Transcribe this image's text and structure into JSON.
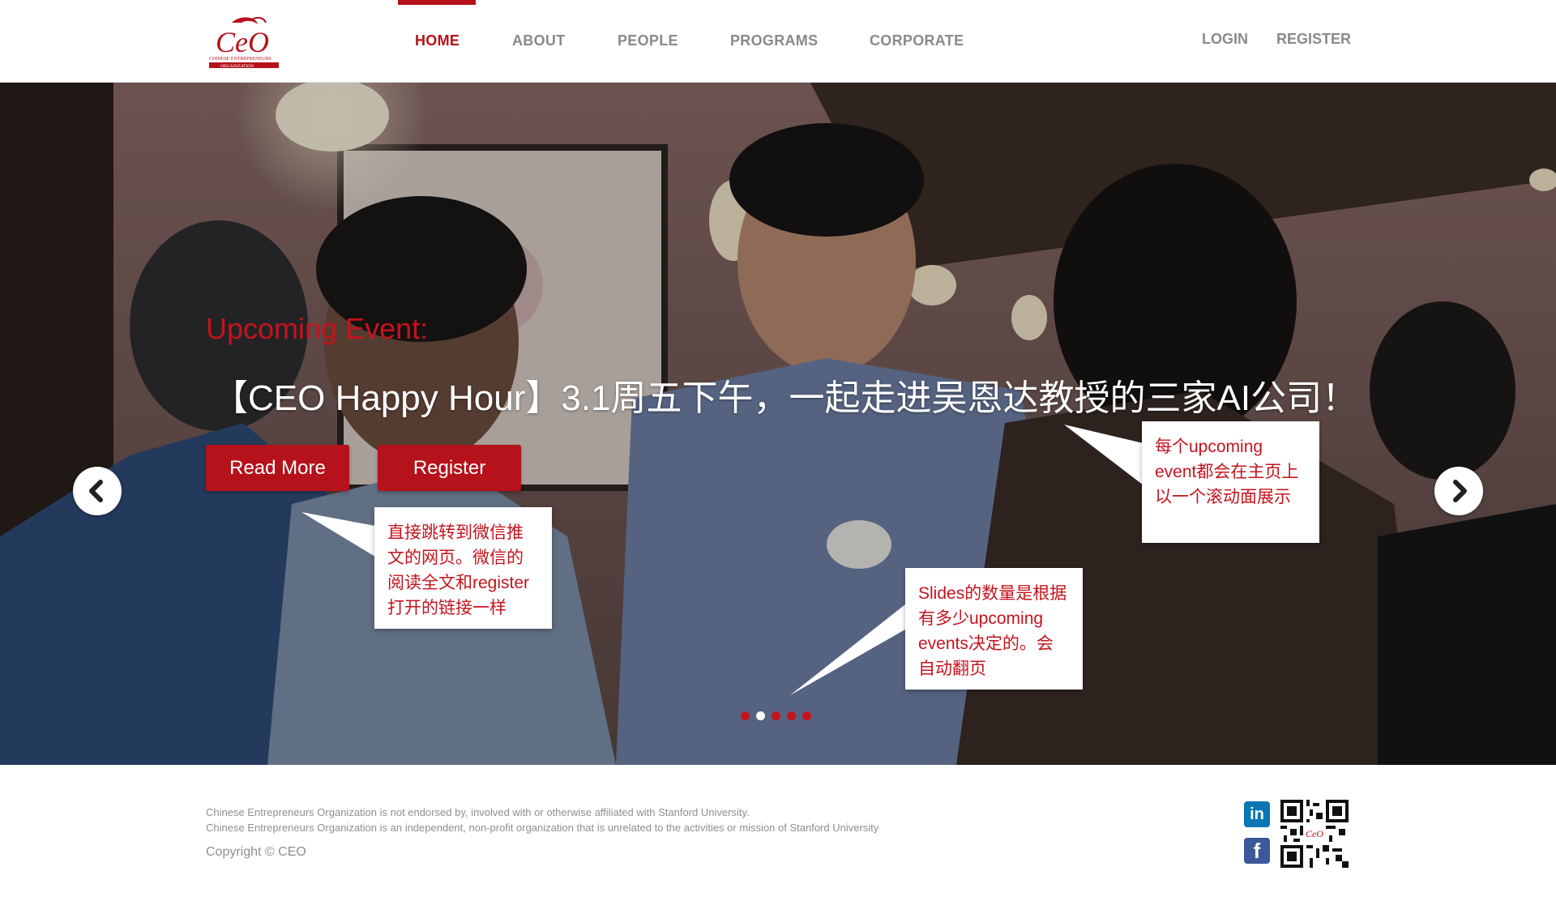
{
  "brand": {
    "logo_letters": "CeO",
    "logo_sub1": "CHINESE ENTREPRENEURS",
    "logo_sub2": "ORGANIZATION",
    "accent_color": "#b5121b"
  },
  "nav": {
    "items": [
      {
        "label": "HOME",
        "active": true
      },
      {
        "label": "ABOUT",
        "active": false
      },
      {
        "label": "PEOPLE",
        "active": false
      },
      {
        "label": "PROGRAMS",
        "active": false
      },
      {
        "label": "CORPORATE",
        "active": false
      }
    ],
    "login": "LOGIN",
    "register": "REGISTER"
  },
  "hero": {
    "kicker": "Upcoming Event:",
    "title": "【CEO Happy Hour】3.1周五下午，一起走进吴恩达教授的三家AI公司！",
    "read_more": "Read More",
    "register": "Register",
    "prev_icon": "chevron-left-icon",
    "next_icon": "chevron-right-icon",
    "slides_total": 5,
    "active_slide": 2
  },
  "annotations": {
    "carousel_note": "每个upcoming event都会在主页上以一个滚动面展示",
    "buttons_note": "直接跳转到微信推文的网页。微信的阅读全文和register打开的链接一样",
    "slides_note": "Slides的数量是根据有多少upcoming events决定的。会自动翻页"
  },
  "footer": {
    "disclaimer1": "Chinese Entrepreneurs Organization is not endorsed by, involved with or otherwise affiliated with Stanford University.",
    "disclaimer2": "Chinese Entrepreneurs Organization is an independent, non-profit organization that is unrelated to the activities or mission of Stanford University",
    "copyright": "Copyright © CEO",
    "linkedin_label": "in",
    "facebook_label": "f"
  }
}
